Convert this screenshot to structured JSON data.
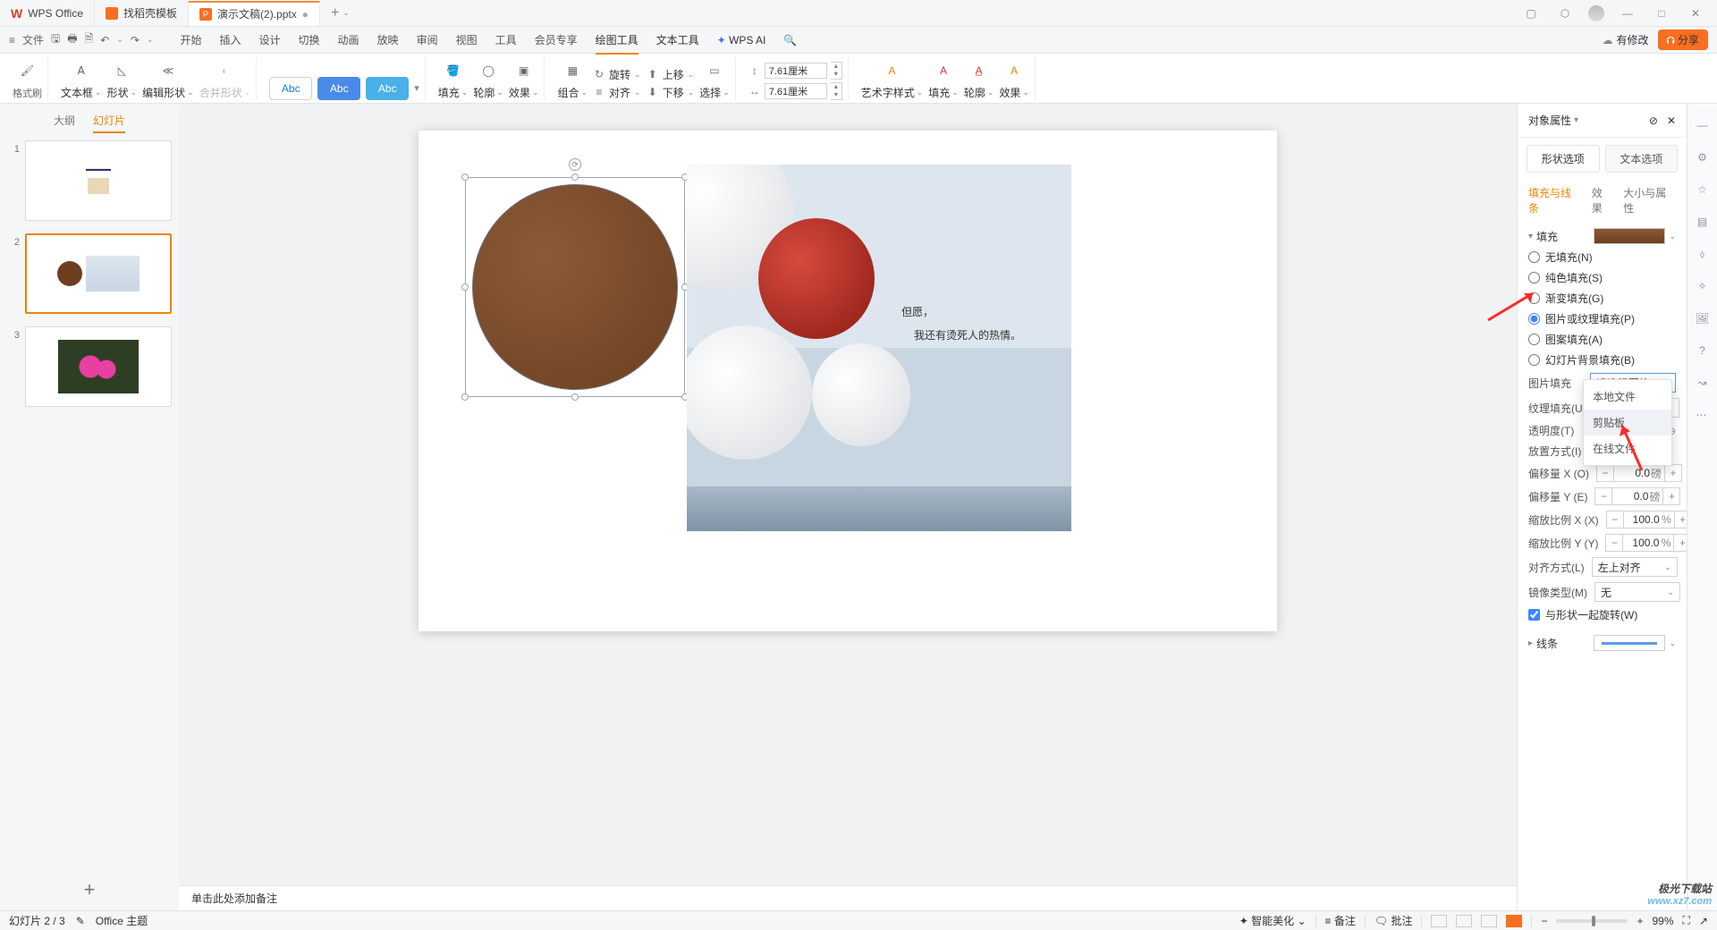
{
  "title_tabs": [
    {
      "icon": "W",
      "label": "WPS Office",
      "close": false
    },
    {
      "icon": "D",
      "label": "找稻壳模板",
      "close": false
    },
    {
      "icon": "P",
      "label": "演示文稿(2).pptx",
      "close": true,
      "active": true
    }
  ],
  "window_controls": {
    "minimize": "—",
    "maximize": "□",
    "close": "✕"
  },
  "qat": {
    "file": "文件"
  },
  "menu": {
    "items": [
      "开始",
      "插入",
      "设计",
      "切换",
      "动画",
      "放映",
      "审阅",
      "视图",
      "工具",
      "会员专享",
      "绘图工具",
      "文本工具",
      "WPS AI"
    ],
    "active_indices": [
      10,
      11
    ],
    "cloud": "有修改",
    "share": "分享"
  },
  "ribbon": {
    "format_brush": "格式刷",
    "text_box": "文本框",
    "shape": "形状",
    "edit_shape": "编辑形状",
    "merge_shape": "合并形状",
    "style_abc": "Abc",
    "styles_more": "▾",
    "fill": "填充",
    "outline": "轮廓",
    "effect": "效果",
    "group": "组合",
    "align": "对齐",
    "rotate": "旋转",
    "up": "上移",
    "down": "下移",
    "select": "选择",
    "height": "7.61厘米",
    "width": "7.61厘米",
    "art_style": "艺术字样式",
    "fill2": "填充",
    "outline2": "轮廓",
    "effect2": "效果"
  },
  "thumbs": {
    "tab_outline": "大纲",
    "tab_slides": "幻灯片",
    "slides": [
      1,
      2,
      3
    ],
    "selected": 2
  },
  "slide": {
    "text_line1": "但愿，",
    "text_line2": "我还有烫死人的热情。",
    "notes_placeholder": "单击此处添加备注"
  },
  "panel": {
    "title": "对象属性",
    "tab_shape": "形状选项",
    "tab_text": "文本选项",
    "sub_fill": "填充与线条",
    "sub_effect": "效果",
    "sub_size": "大小与属性",
    "sect_fill": "填充",
    "sect_line": "线条",
    "radio_none": "无填充(N)",
    "radio_solid": "纯色填充(S)",
    "radio_gradient": "渐变填充(G)",
    "radio_picture": "图片或纹理填充(P)",
    "radio_pattern": "图案填充(A)",
    "radio_slidebg": "幻灯片背景填充(B)",
    "lbl_picfill": "图片填充",
    "sel_picfill": "请选择图片",
    "lbl_texture": "纹理填充(U)",
    "lbl_trans": "透明度(T)",
    "lbl_place": "放置方式(I)",
    "lbl_offx": "偏移量 X (O)",
    "lbl_offy": "偏移量 Y (E)",
    "lbl_sclx": "缩放比例 X (X)",
    "lbl_scly": "缩放比例 Y (Y)",
    "lbl_align": "对齐方式(L)",
    "sel_align": "左上对齐",
    "lbl_mirror": "镜像类型(M)",
    "sel_mirror": "无",
    "chk_rotate": "与形状一起旋转(W)",
    "val_off": "0.0",
    "unit_pt": "磅",
    "val_scale": "100.0",
    "unit_pct": "%",
    "popup": [
      "本地文件",
      "剪贴板",
      "在线文件"
    ],
    "popup_hov": 1
  },
  "status": {
    "page": "幻灯片 2 / 3",
    "theme": "Office 主题",
    "smart": "智能美化",
    "notes": "备注",
    "comments": "批注",
    "zoom": "99%",
    "zoom_minus": "−",
    "zoom_plus": "+"
  },
  "watermark": {
    "l1": "极光下载站",
    "l2": "www.xz7.com"
  }
}
